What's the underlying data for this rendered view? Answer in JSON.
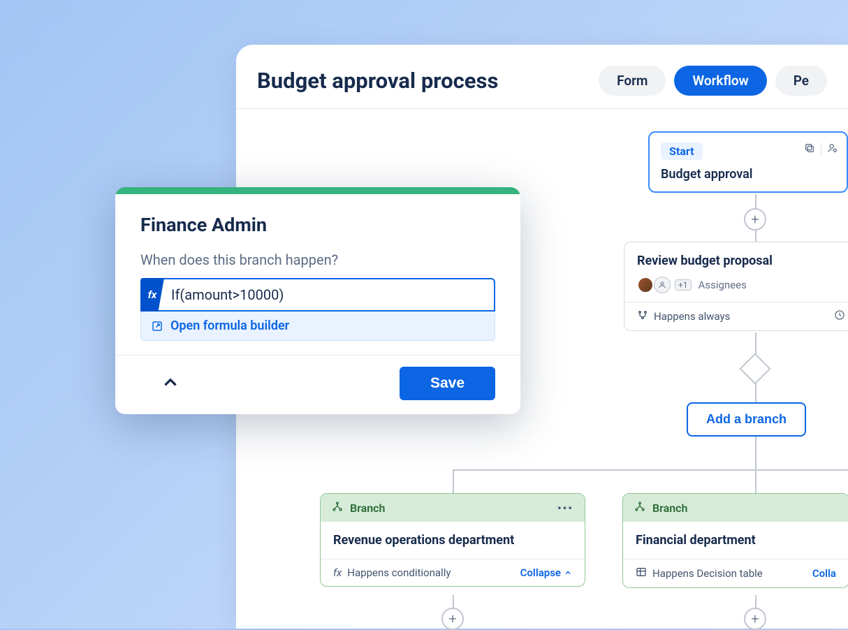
{
  "page": {
    "title": "Budget approval process"
  },
  "tabs": {
    "form": "Form",
    "workflow": "Workflow",
    "third": "Pe"
  },
  "start": {
    "badge": "Start",
    "title": "Budget approval"
  },
  "review": {
    "title": "Review budget proposal",
    "assignees_label": "Assignees",
    "extra_count": "+1",
    "footer": "Happens always"
  },
  "add_branch": "Add a branch",
  "branch_label": "Branch",
  "collapse": "Collapse",
  "collapse_partial": "Colla",
  "branch1": {
    "title": "Revenue operations department",
    "condition": "Happens conditionally"
  },
  "branch2": {
    "title": "Financial department",
    "condition": "Happens Decision table"
  },
  "modal": {
    "title": "Finance Admin",
    "question": "When does this branch happen?",
    "formula": "If(amount>10000)",
    "fx": "fx",
    "builder_link": "Open formula builder",
    "save": "Save"
  }
}
